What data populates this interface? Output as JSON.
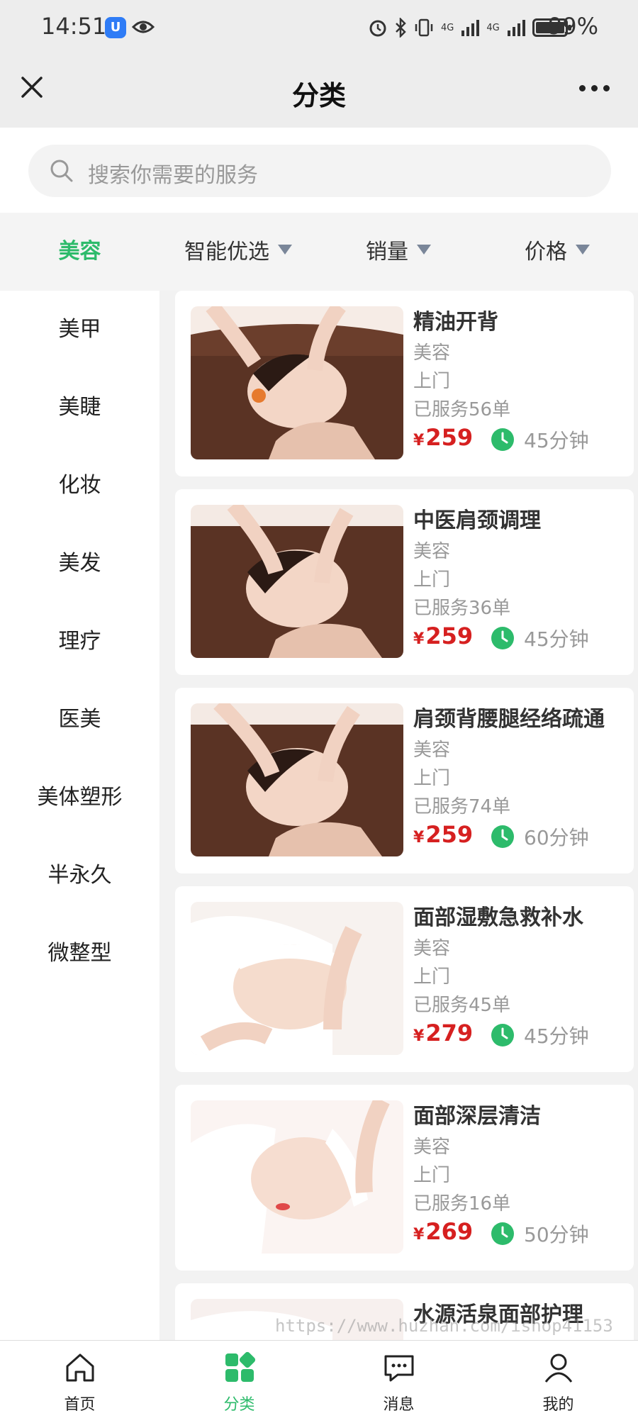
{
  "status_bar": {
    "time": "14:51",
    "battery": "99%",
    "battery_level": 0.99,
    "network_1": "4G",
    "network_2": "4G"
  },
  "nav": {
    "title": "分类"
  },
  "search": {
    "placeholder": "搜索你需要的服务"
  },
  "categories": {
    "active": "美容",
    "items": [
      "美甲",
      "美睫",
      "化妆",
      "美发",
      "理疗",
      "医美",
      "美体塑形",
      "半永久",
      "微整型"
    ]
  },
  "sort": {
    "smart": "智能优选",
    "sales": "销量",
    "price": "价格"
  },
  "products": [
    {
      "title": "精油开背",
      "category": "美容",
      "mode": "上门",
      "served": "已服务56单",
      "currency": "¥",
      "price": "259",
      "duration": "45分钟"
    },
    {
      "title": "中医肩颈调理",
      "category": "美容",
      "mode": "上门",
      "served": "已服务36单",
      "currency": "¥",
      "price": "259",
      "duration": "45分钟"
    },
    {
      "title": "肩颈背腰腿经络疏通",
      "category": "美容",
      "mode": "上门",
      "served": "已服务74单",
      "currency": "¥",
      "price": "259",
      "duration": "60分钟"
    },
    {
      "title": "面部湿敷急救补水",
      "category": "美容",
      "mode": "上门",
      "served": "已服务45单",
      "currency": "¥",
      "price": "279",
      "duration": "45分钟"
    },
    {
      "title": "面部深层清洁",
      "category": "美容",
      "mode": "上门",
      "served": "已服务16单",
      "currency": "¥",
      "price": "269",
      "duration": "50分钟"
    },
    {
      "title": "水源活泉面部护理",
      "category": "",
      "mode": "",
      "served": "",
      "currency": "",
      "price": "",
      "duration": ""
    }
  ],
  "watermark": "https://www.huzhan.com/ishop41153",
  "tabbar": {
    "home": "首页",
    "category": "分类",
    "messages": "消息",
    "mine": "我的"
  },
  "colors": {
    "accent": "#2dbb6b",
    "price": "#d62020"
  }
}
